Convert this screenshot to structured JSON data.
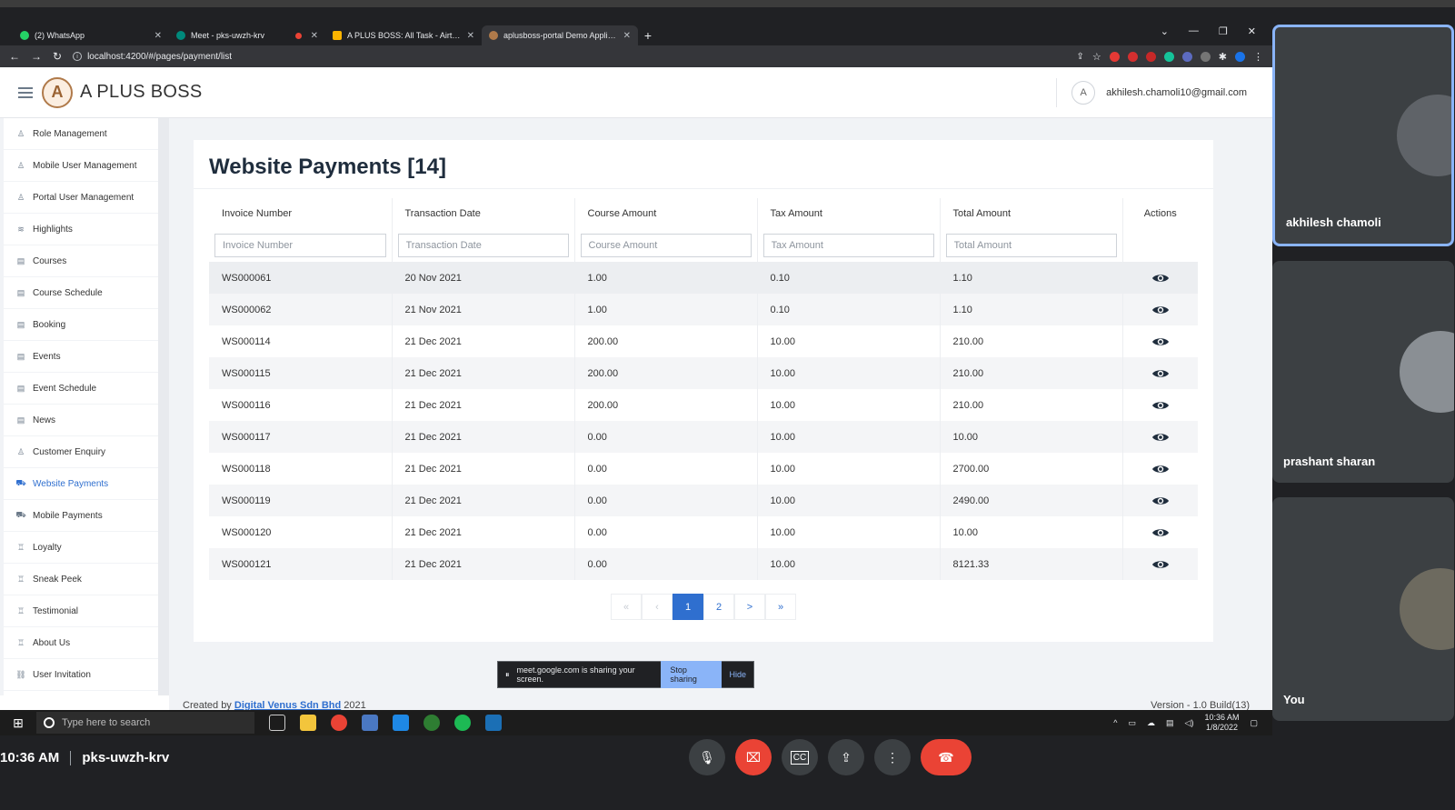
{
  "browser": {
    "tabs": [
      {
        "title": "(2) WhatsApp",
        "color": "#25d366"
      },
      {
        "title": "Meet - pks-uwzh-krv",
        "color": "#00897b",
        "recording": true
      },
      {
        "title": "A PLUS BOSS: All Task - Airtable",
        "color": "#fcb400"
      },
      {
        "title": "aplusboss-portal Demo Applicatio",
        "color": "#b07a4a"
      }
    ],
    "url": "localhost:4200/#/pages/payment/list"
  },
  "app": {
    "brand": "A PLUS BOSS",
    "user_initial": "A",
    "user_email": "akhilesh.chamoli10@gmail.com"
  },
  "sidebar": {
    "items": [
      {
        "label": "Role Management",
        "icon": "person-icon"
      },
      {
        "label": "Mobile User Management",
        "icon": "person-icon"
      },
      {
        "label": "Portal User Management",
        "icon": "person-icon"
      },
      {
        "label": "Highlights",
        "icon": "layers-icon"
      },
      {
        "label": "Courses",
        "icon": "file-icon"
      },
      {
        "label": "Course Schedule",
        "icon": "file-icon"
      },
      {
        "label": "Booking",
        "icon": "file-icon"
      },
      {
        "label": "Events",
        "icon": "file-icon"
      },
      {
        "label": "Event Schedule",
        "icon": "file-icon"
      },
      {
        "label": "News",
        "icon": "file-icon"
      },
      {
        "label": "Customer Enquiry",
        "icon": "person-icon"
      },
      {
        "label": "Website Payments",
        "icon": "cart-icon",
        "active": true
      },
      {
        "label": "Mobile Payments",
        "icon": "cart-icon"
      },
      {
        "label": "Loyalty",
        "icon": "award-icon"
      },
      {
        "label": "Sneak Peek",
        "icon": "award-icon"
      },
      {
        "label": "Testimonial",
        "icon": "award-icon"
      },
      {
        "label": "About Us",
        "icon": "award-icon"
      },
      {
        "label": "User Invitation",
        "icon": "link-icon"
      }
    ]
  },
  "main": {
    "title": "Website Payments [14]",
    "columns": [
      "Invoice Number",
      "Transaction Date",
      "Course Amount",
      "Tax Amount",
      "Total Amount",
      "Actions"
    ],
    "filters": [
      "Invoice Number",
      "Transaction Date",
      "Course Amount",
      "Tax Amount",
      "Total Amount"
    ],
    "rows": [
      [
        "WS000061",
        "20 Nov 2021",
        "1.00",
        "0.10",
        "1.10"
      ],
      [
        "WS000062",
        "21 Nov 2021",
        "1.00",
        "0.10",
        "1.10"
      ],
      [
        "WS000114",
        "21 Dec 2021",
        "200.00",
        "10.00",
        "210.00"
      ],
      [
        "WS000115",
        "21 Dec 2021",
        "200.00",
        "10.00",
        "210.00"
      ],
      [
        "WS000116",
        "21 Dec 2021",
        "200.00",
        "10.00",
        "210.00"
      ],
      [
        "WS000117",
        "21 Dec 2021",
        "0.00",
        "10.00",
        "10.00"
      ],
      [
        "WS000118",
        "21 Dec 2021",
        "0.00",
        "10.00",
        "2700.00"
      ],
      [
        "WS000119",
        "21 Dec 2021",
        "0.00",
        "10.00",
        "2490.00"
      ],
      [
        "WS000120",
        "21 Dec 2021",
        "0.00",
        "10.00",
        "10.00"
      ],
      [
        "WS000121",
        "21 Dec 2021",
        "0.00",
        "10.00",
        "8121.33"
      ]
    ],
    "pagination": {
      "first": "«",
      "prev": "‹",
      "pages": [
        "1",
        "2"
      ],
      "current": "1",
      "next": ">",
      "last": "»"
    }
  },
  "footer": {
    "created_prefix": "Created by",
    "company": "Digital Venus Sdn Bhd",
    "year": "2021",
    "version": "Version - 1.0 Build(13)"
  },
  "share_banner": {
    "text": "meet.google.com is sharing your screen.",
    "stop": "Stop sharing",
    "hide": "Hide"
  },
  "taskbar": {
    "search_placeholder": "Type here to search",
    "time": "10:36 AM",
    "date": "1/8/2022"
  },
  "meet": {
    "time": "10:36 AM",
    "code": "pks-uwzh-krv",
    "participants": [
      "akhilesh chamoli",
      "prashant sharan",
      "You"
    ]
  },
  "colors": {
    "accent": "#2f6fcf",
    "end_call": "#ea4335"
  }
}
